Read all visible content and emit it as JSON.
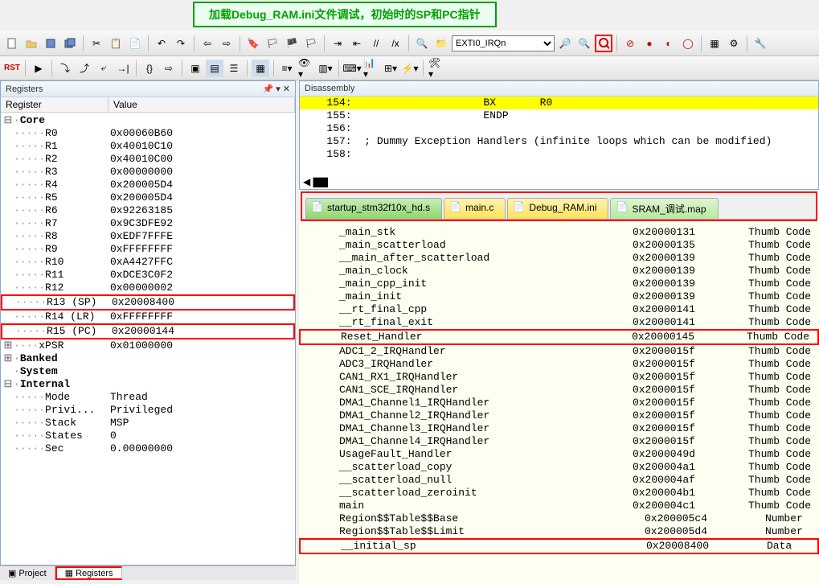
{
  "annotation": "加载Debug_RAM.ini文件调试，初始时的SP和PC指针",
  "search_combo": "EXTI0_IRQn",
  "registers_panel": {
    "title": "Registers",
    "col_register": "Register",
    "col_value": "Value"
  },
  "reg_core": "Core",
  "regs": [
    {
      "n": "R0",
      "v": "0x00060B60"
    },
    {
      "n": "R1",
      "v": "0x40010C10"
    },
    {
      "n": "R2",
      "v": "0x40010C00"
    },
    {
      "n": "R3",
      "v": "0x00000000"
    },
    {
      "n": "R4",
      "v": "0x200005D4"
    },
    {
      "n": "R5",
      "v": "0x200005D4"
    },
    {
      "n": "R6",
      "v": "0x92263185"
    },
    {
      "n": "R7",
      "v": "0x9C3DFE92"
    },
    {
      "n": "R8",
      "v": "0xEDF7FFFE"
    },
    {
      "n": "R9",
      "v": "0xFFFFFFFF"
    },
    {
      "n": "R10",
      "v": "0xA4427FFC"
    },
    {
      "n": "R11",
      "v": "0xDCE3C0F2"
    },
    {
      "n": "R12",
      "v": "0x00000002"
    }
  ],
  "reg_sp": {
    "n": "R13 (SP)",
    "v": "0x20008400"
  },
  "reg_lr": {
    "n": "R14 (LR)",
    "v": "0xFFFFFFFF"
  },
  "reg_pc": {
    "n": "R15 (PC)",
    "v": "0x20000144"
  },
  "reg_xpsr": {
    "n": "xPSR",
    "v": "0x01000000"
  },
  "reg_groups": [
    "Banked",
    "System",
    "Internal"
  ],
  "internal": [
    {
      "n": "Mode",
      "v": "Thread"
    },
    {
      "n": "Privi...",
      "v": "Privileged"
    },
    {
      "n": "Stack",
      "v": "MSP"
    },
    {
      "n": "States",
      "v": "0"
    },
    {
      "n": "Sec",
      "v": "0.00000000"
    }
  ],
  "bottom_tabs": {
    "project": "Project",
    "registers": "Registers"
  },
  "disasm_title": "Disassembly",
  "disasm": [
    {
      "ln": "154:",
      "txt": "                    BX       R0",
      "hl": true
    },
    {
      "ln": "155:",
      "txt": "                    ENDP",
      "hl": false
    },
    {
      "ln": "156:",
      "txt": "",
      "hl": false
    },
    {
      "ln": "157:",
      "txt": " ; Dummy Exception Handlers (infinite loops which can be modified)",
      "hl": false
    },
    {
      "ln": "158:",
      "txt": "",
      "hl": false
    }
  ],
  "tabs": [
    {
      "label": "startup_stm32f10x_hd.s",
      "cls": "green"
    },
    {
      "label": "main.c",
      "cls": "yellow"
    },
    {
      "label": "Debug_RAM.ini",
      "cls": "yellow"
    },
    {
      "label": "SRAM_调试.map",
      "cls": "active"
    }
  ],
  "map": [
    {
      "s": "_main_stk",
      "a": "0x20000131",
      "t": "Thumb Code"
    },
    {
      "s": "_main_scatterload",
      "a": "0x20000135",
      "t": "Thumb Code"
    },
    {
      "s": "__main_after_scatterload",
      "a": "0x20000139",
      "t": "Thumb Code"
    },
    {
      "s": "_main_clock",
      "a": "0x20000139",
      "t": "Thumb Code"
    },
    {
      "s": "_main_cpp_init",
      "a": "0x20000139",
      "t": "Thumb Code"
    },
    {
      "s": "_main_init",
      "a": "0x20000139",
      "t": "Thumb Code"
    },
    {
      "s": "__rt_final_cpp",
      "a": "0x20000141",
      "t": "Thumb Code"
    },
    {
      "s": "__rt_final_exit",
      "a": "0x20000141",
      "t": "Thumb Code"
    },
    {
      "s": "Reset_Handler",
      "a": "0x20000145",
      "t": "Thumb Code",
      "red": true
    },
    {
      "s": "ADC1_2_IRQHandler",
      "a": "0x2000015f",
      "t": "Thumb Code"
    },
    {
      "s": "ADC3_IRQHandler",
      "a": "0x2000015f",
      "t": "Thumb Code"
    },
    {
      "s": "CAN1_RX1_IRQHandler",
      "a": "0x2000015f",
      "t": "Thumb Code"
    },
    {
      "s": "CAN1_SCE_IRQHandler",
      "a": "0x2000015f",
      "t": "Thumb Code"
    },
    {
      "s": "DMA1_Channel1_IRQHandler",
      "a": "0x2000015f",
      "t": "Thumb Code"
    },
    {
      "s": "DMA1_Channel2_IRQHandler",
      "a": "0x2000015f",
      "t": "Thumb Code"
    },
    {
      "s": "DMA1_Channel3_IRQHandler",
      "a": "0x2000015f",
      "t": "Thumb Code"
    },
    {
      "s": "DMA1_Channel4_IRQHandler",
      "a": "0x2000015f",
      "t": "Thumb Code"
    },
    {
      "s": "UsageFault_Handler",
      "a": "0x2000049d",
      "t": "Thumb Code"
    },
    {
      "s": "__scatterload_copy",
      "a": "0x200004a1",
      "t": "Thumb Code"
    },
    {
      "s": "__scatterload_null",
      "a": "0x200004af",
      "t": "Thumb Code"
    },
    {
      "s": "__scatterload_zeroinit",
      "a": "0x200004b1",
      "t": "Thumb Code"
    },
    {
      "s": "main",
      "a": "0x200004c1",
      "t": "Thumb Code"
    },
    {
      "s": "Region$$Table$$Base",
      "a": "0x200005c4",
      "t": "Number"
    },
    {
      "s": "Region$$Table$$Limit",
      "a": "0x200005d4",
      "t": "Number"
    },
    {
      "s": "__initial_sp",
      "a": "0x20008400",
      "t": "Data",
      "red": true
    }
  ]
}
